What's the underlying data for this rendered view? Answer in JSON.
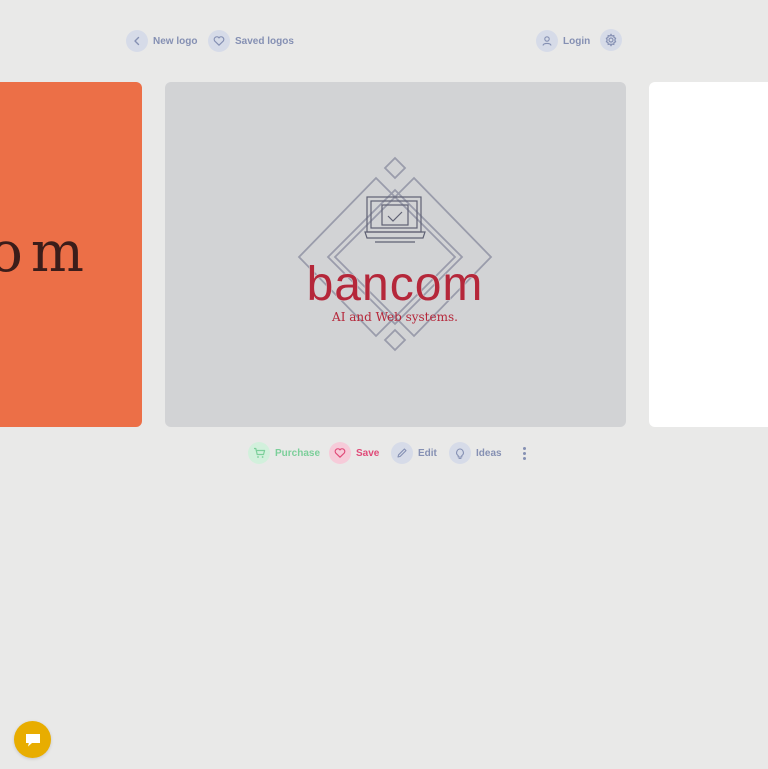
{
  "nav": {
    "new_logo": "New logo",
    "saved_logos": "Saved logos",
    "login": "Login"
  },
  "logo": {
    "name": "bancom",
    "tagline": "AI and Web systems.",
    "name_color": "#b5273a",
    "frame_color": "#9a9cab",
    "background": "#d2d3d5"
  },
  "prev_card": {
    "partial_text": "om",
    "background": "#ec6f47",
    "text_color": "#3b1d1a"
  },
  "next_card": {
    "background": "#ffffff"
  },
  "actions": {
    "purchase": "Purchase",
    "save": "Save",
    "edit": "Edit",
    "ideas": "Ideas"
  },
  "colors": {
    "page_bg": "#e9e9e8",
    "nav_text": "#8590b3",
    "purchase": "#7ccf9a",
    "save": "#e04a78",
    "chat_button": "#e8ad00"
  }
}
